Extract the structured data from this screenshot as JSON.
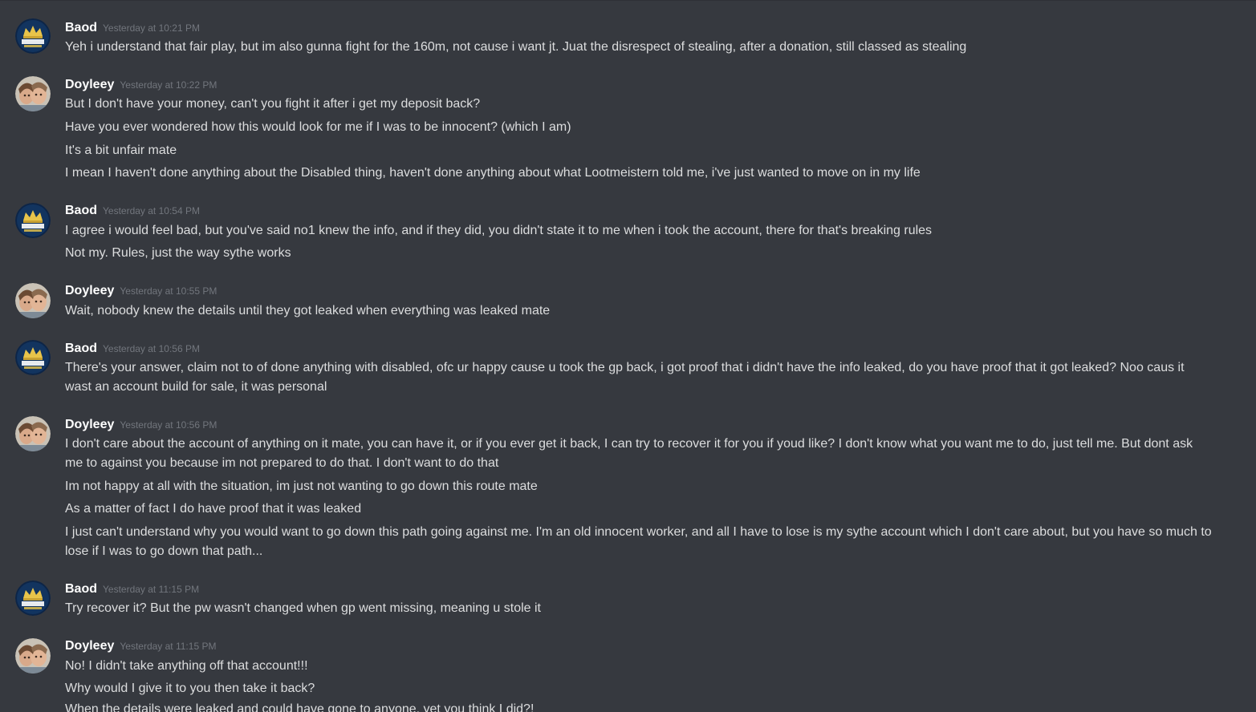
{
  "colors": {
    "background": "#36393f",
    "username": "#ffffff",
    "timestamp": "#72767d",
    "text": "#dcddde"
  },
  "groups": [
    {
      "author": "Baod",
      "avatar": "crown-owner-icon",
      "time": "Yesterday at 10:21 PM",
      "messages": [
        "Yeh i understand that fair play, but im also gunna fight for the 160m, not cause i want jt. Juat the disrespect of stealing, after a donation, still classed as stealing"
      ]
    },
    {
      "author": "Doyleey",
      "avatar": "user-photo-avatar",
      "time": "Yesterday at 10:22 PM",
      "messages": [
        "But I don't have your money, can't you fight it after i get my deposit back?",
        "Have you ever wondered how this would look for me if I was to be innocent? (which I am)",
        "It's a bit unfair mate",
        "I mean I haven't done anything about the Disabled thing, haven't done anything about what Lootmeistern told me, i've just wanted to move on in my life"
      ]
    },
    {
      "author": "Baod",
      "avatar": "crown-owner-icon",
      "time": "Yesterday at 10:54 PM",
      "messages": [
        "I agree i would feel bad, but you've said no1 knew the info, and if they did, you didn't state it to  me when i took the account, there for that's breaking rules",
        "Not my. Rules, just the way sythe works"
      ]
    },
    {
      "author": "Doyleey",
      "avatar": "user-photo-avatar",
      "time": "Yesterday at 10:55 PM",
      "messages": [
        "Wait, nobody knew the details until they got leaked when everything was leaked mate"
      ]
    },
    {
      "author": "Baod",
      "avatar": "crown-owner-icon",
      "time": "Yesterday at 10:56 PM",
      "messages": [
        "There's your answer, claim not to of done anything with disabled, ofc ur happy cause u took the gp back, i got proof that i didn't have the info leaked, do you have proof that it got leaked? Noo caus it wast an account build for sale, it was personal"
      ]
    },
    {
      "author": "Doyleey",
      "avatar": "user-photo-avatar",
      "time": "Yesterday at 10:56 PM",
      "messages": [
        "I don't care about the account of anything on it mate, you can have it, or if you ever get it back, I can try to recover it for you if youd like? I don't know what you want me to do, just tell me. But dont ask me to against you because im not prepared to do that. I don't want to do that",
        "Im not happy at all with the situation, im just not wanting to go down this route mate",
        "As a matter of fact I do have proof that it was leaked",
        "I just can't understand why you would want to go down this path going against me. I'm an old innocent worker, and all I have to lose is my sythe account which I don't care about, but you have so much to lose if I was to go down that path..."
      ]
    },
    {
      "author": "Baod",
      "avatar": "crown-owner-icon",
      "time": "Yesterday at 11:15 PM",
      "messages": [
        "Try recover it? But the pw wasn't changed when gp went missing, meaning u stole it"
      ]
    },
    {
      "author": "Doyleey",
      "avatar": "user-photo-avatar",
      "time": "Yesterday at 11:15 PM",
      "messages": [
        "No! I didn't take anything off that account!!!",
        "Why would I give it to you then take it back?",
        "When the details were leaked and could have gone to anyone, yet you think I did?!"
      ]
    }
  ]
}
